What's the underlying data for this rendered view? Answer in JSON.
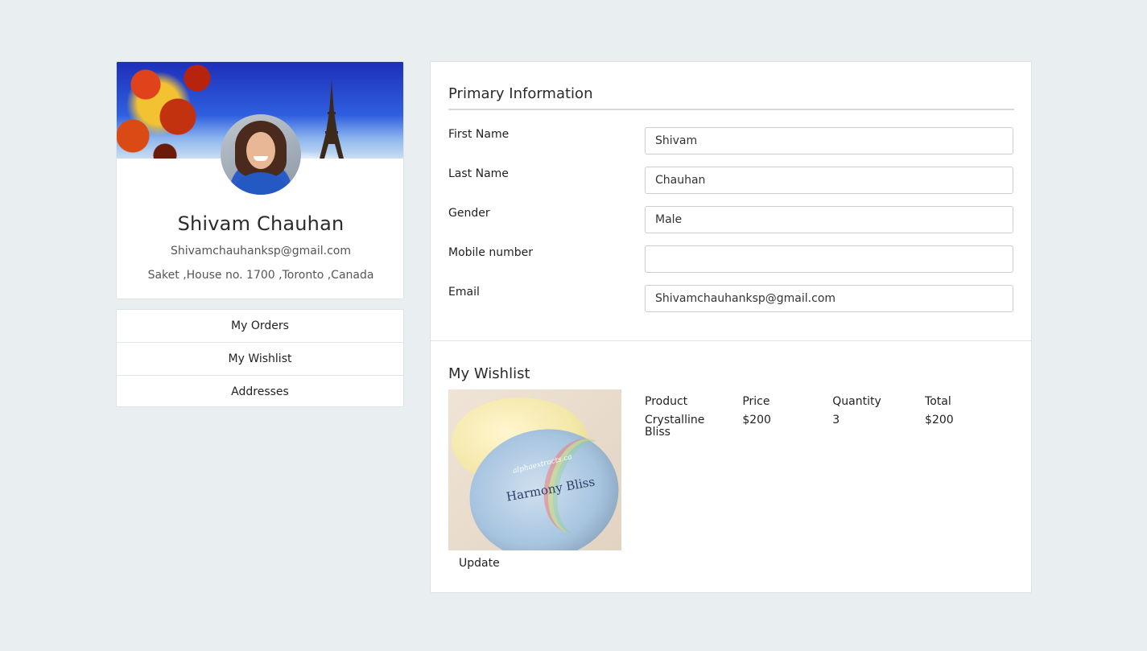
{
  "profile": {
    "name": "Shivam Chauhan",
    "email": "Shivamchauhanksp@gmail.com",
    "address": "Saket ,House no. 1700 ,Toronto ,Canada"
  },
  "sidebar": {
    "items": [
      {
        "label": "My Orders"
      },
      {
        "label": "My Wishlist"
      },
      {
        "label": "Addresses"
      }
    ]
  },
  "primary_info": {
    "title": "Primary Information",
    "fields": [
      {
        "label": "First Name",
        "value": "Shivam"
      },
      {
        "label": "Last Name",
        "value": "Chauhan"
      },
      {
        "label": "Gender",
        "value": "Male"
      },
      {
        "label": "Mobile number",
        "value": ""
      },
      {
        "label": "Email",
        "value": "Shivamchauhanksp@gmail.com"
      }
    ]
  },
  "wishlist": {
    "title": "My Wishlist",
    "image_label": "Harmony Bliss",
    "image_brand": "alphaextracts.ca",
    "update_label": "Update",
    "columns": [
      "Product",
      "Price",
      "Quantity",
      "Total"
    ],
    "rows": [
      {
        "product": "Crystalline Bliss",
        "price": "$200",
        "quantity": "3",
        "total": "$200"
      }
    ]
  },
  "colors": {
    "background": "#e9eff0",
    "card": "#ffffff",
    "border": "#dde3e5"
  }
}
